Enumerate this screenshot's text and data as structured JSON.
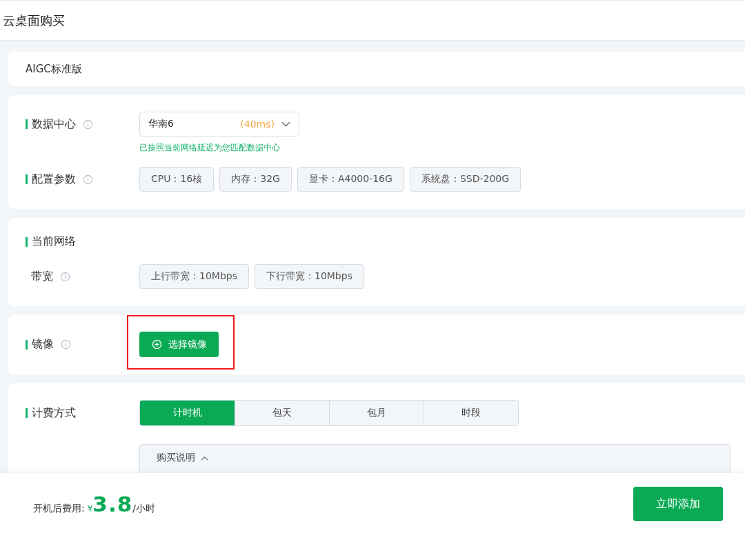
{
  "page": {
    "title": "云桌面购买"
  },
  "plan": {
    "name": "AIGC标准版"
  },
  "datacenter": {
    "label": "数据中心",
    "value": "华南6",
    "latency": "(40ms)",
    "hint": "已按照当前网络延迟为您匹配数据中心"
  },
  "config": {
    "label": "配置参数",
    "specs": [
      "CPU：16核",
      "内存：32G",
      "显卡：A4000-16G",
      "系统盘：SSD-200G"
    ]
  },
  "network": {
    "title": "当前网络",
    "label": "带宽",
    "specs": [
      "上行带宽：10Mbps",
      "下行带宽：10Mbps"
    ]
  },
  "image": {
    "label": "镜像",
    "button": "选择镜像",
    "highlighted": true
  },
  "billing": {
    "label": "计费方式",
    "options": [
      {
        "label": "计时机",
        "selected": true
      },
      {
        "label": "包天",
        "selected": false
      },
      {
        "label": "包月",
        "selected": false
      },
      {
        "label": "时段",
        "selected": false
      }
    ],
    "notes": {
      "label": "购买说明",
      "expanded": true
    }
  },
  "footer": {
    "fee_label": "开机后费用:",
    "currency": "¥",
    "price": "3.8",
    "unit": "/小时",
    "button": "立即添加"
  }
}
